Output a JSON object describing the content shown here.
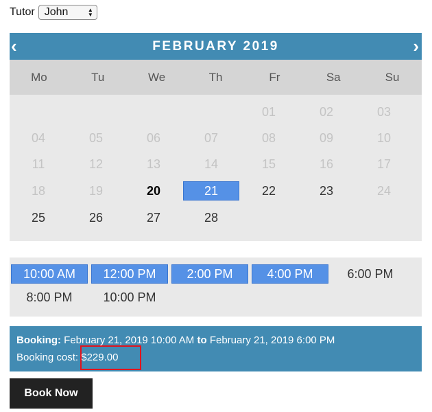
{
  "tutor": {
    "label": "Tutor",
    "selected": "John"
  },
  "calendar": {
    "prev_icon": "‹",
    "next_icon": "›",
    "title": "FEBRUARY 2019",
    "weekdays": [
      "Mo",
      "Tu",
      "We",
      "Th",
      "Fr",
      "Sa",
      "Su"
    ],
    "weeks": [
      [
        {
          "label": "",
          "state": "empty"
        },
        {
          "label": "",
          "state": "empty"
        },
        {
          "label": "",
          "state": "empty"
        },
        {
          "label": "",
          "state": "empty"
        },
        {
          "label": "01",
          "state": "disabled"
        },
        {
          "label": "02",
          "state": "disabled"
        },
        {
          "label": "03",
          "state": "disabled"
        }
      ],
      [
        {
          "label": "04",
          "state": "disabled"
        },
        {
          "label": "05",
          "state": "disabled"
        },
        {
          "label": "06",
          "state": "disabled"
        },
        {
          "label": "07",
          "state": "disabled"
        },
        {
          "label": "08",
          "state": "disabled"
        },
        {
          "label": "09",
          "state": "disabled"
        },
        {
          "label": "10",
          "state": "disabled"
        }
      ],
      [
        {
          "label": "11",
          "state": "disabled"
        },
        {
          "label": "12",
          "state": "disabled"
        },
        {
          "label": "13",
          "state": "disabled"
        },
        {
          "label": "14",
          "state": "disabled"
        },
        {
          "label": "15",
          "state": "disabled"
        },
        {
          "label": "16",
          "state": "disabled"
        },
        {
          "label": "17",
          "state": "disabled"
        }
      ],
      [
        {
          "label": "18",
          "state": "disabled"
        },
        {
          "label": "19",
          "state": "disabled"
        },
        {
          "label": "20",
          "state": "today"
        },
        {
          "label": "21",
          "state": "selected"
        },
        {
          "label": "22",
          "state": "available"
        },
        {
          "label": "23",
          "state": "available"
        },
        {
          "label": "24",
          "state": "disabled"
        }
      ],
      [
        {
          "label": "25",
          "state": "available"
        },
        {
          "label": "26",
          "state": "available"
        },
        {
          "label": "27",
          "state": "available"
        },
        {
          "label": "28",
          "state": "available"
        },
        {
          "label": "",
          "state": "empty"
        },
        {
          "label": "",
          "state": "empty"
        },
        {
          "label": "",
          "state": "empty"
        }
      ]
    ]
  },
  "time_slots": [
    {
      "label": "10:00 AM",
      "active": true
    },
    {
      "label": "12:00 PM",
      "active": true
    },
    {
      "label": "2:00 PM",
      "active": true
    },
    {
      "label": "4:00 PM",
      "active": true
    },
    {
      "label": "6:00 PM",
      "active": false
    },
    {
      "label": "8:00 PM",
      "active": false
    },
    {
      "label": "10:00 PM",
      "active": false
    }
  ],
  "booking": {
    "label": "Booking:",
    "start": "February 21, 2019 10:00 AM",
    "to": "to",
    "end": "February 21, 2019 6:00 PM",
    "cost_label": "Booking cost:",
    "cost_value": "$229.00"
  },
  "book_button": "Book Now",
  "colors": {
    "accent": "#428bb3",
    "selected": "#5591e6",
    "panel": "#e9e9e9",
    "highlight": "#e0141e"
  }
}
